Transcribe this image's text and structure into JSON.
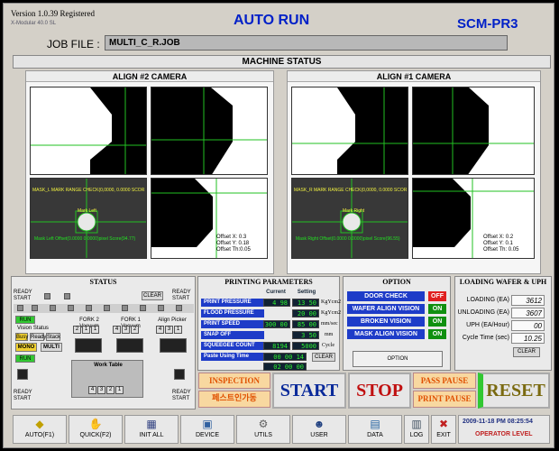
{
  "header": {
    "version": "Version 1.0.39   Registered",
    "subtitle": "X-Modular 40.0 SL",
    "title": "AUTO RUN",
    "model": "SCM-PR3"
  },
  "job": {
    "label": "JOB FILE :",
    "value": "MULTI_C_R.JOB"
  },
  "machine_status": {
    "title": "MACHINE STATUS"
  },
  "cameras": {
    "align2": {
      "title": "ALIGN #2 CAMERA",
      "mask_text": "MASK_L MARK RANGE CHECK(0,0000, 0.0000 SCOR",
      "mark_label": "Mark Left",
      "mark_info": "Mask Left Offset(0.0000 0.0000)pixel Score(94.77)",
      "offset_x": "Offset X:  0.3",
      "offset_y": "Offset Y:  0.18",
      "offset_th": "Offset Th:0.05"
    },
    "align1": {
      "title": "ALIGN #1 CAMERA",
      "mask_text": "MASK_R MARK RANGE CHECK(0,0000, 0.0000 SCOR",
      "mark_label": "Mark Right",
      "mark_info": "Mask Right Offset(0.0000 0.0000)pixel Score(96.55)",
      "offset_x": "Offset X:  0.2",
      "offset_y": "Offset Y:  0.1",
      "offset_th": "Offset Th: 0.05"
    }
  },
  "status": {
    "title": "STATUS",
    "ready": "READY",
    "start": "START",
    "clear": "CLEAR",
    "run": "RUN",
    "vision_status": "Vision Status",
    "busy": "Busy",
    "ready_small": "Ready",
    "stack": "Stack",
    "mono": "MONO",
    "multi": "MULTI",
    "fork2": "FORK 2 Vacuum",
    "fork1": "FORK 1 Vacuum",
    "align_picker": "Align Picker",
    "work_table": "Work Table",
    "nums": [
      "2",
      "1",
      "1",
      "4",
      "3",
      "2",
      "1"
    ]
  },
  "printing": {
    "title": "PRINTING PARAMETERS",
    "col_current": "Current",
    "col_setting": "Setting",
    "rows": [
      {
        "label": "PRINT PRESSURE",
        "current": "4 98",
        "setting": "13 50",
        "unit": "KgYcm2"
      },
      {
        "label": "FLOOD PRESSURE",
        "current": "",
        "setting": "20 00",
        "unit": "KgYcm2"
      },
      {
        "label": "PRINT SPEED",
        "current": "300 00",
        "setting": "85 00",
        "unit": "mm/sec"
      },
      {
        "label": "SNAP OFF",
        "current": "",
        "setting": "3 50",
        "unit": "mm"
      },
      {
        "label": "SQUEEGEE COUNT",
        "current": "8194",
        "setting": "5000",
        "unit": "Cycle"
      },
      {
        "label": "Paste Using Time",
        "current": "00 00 14",
        "setting": "",
        "unit": ""
      }
    ],
    "clear": "CLEAR",
    "extra": "02 00 00"
  },
  "option": {
    "title": "OPTION",
    "rows": [
      {
        "label": "DOOR CHECK",
        "state": "OFF",
        "color": "#e02020"
      },
      {
        "label": "WAFER ALIGN VISION",
        "state": "ON",
        "color": "#109010"
      },
      {
        "label": "BROKEN VISION",
        "state": "ON",
        "color": "#109010"
      },
      {
        "label": "MASK ALIGN VISION",
        "state": "ON",
        "color": "#109010"
      }
    ],
    "button": "OPTION"
  },
  "loading": {
    "title": "LOADING WAFER & UPH",
    "rows": [
      {
        "label": "LOADING (EA)",
        "value": "3612"
      },
      {
        "label": "UNLOADING (EA)",
        "value": "3607"
      },
      {
        "label": "UPH (EA/Hour)",
        "value": "00"
      },
      {
        "label": "Cycle Time (sec)",
        "value": "10.25"
      }
    ],
    "clear": "CLEAR"
  },
  "controls": {
    "inspection": "INSPECTION",
    "paste": "페스트인가동",
    "start": "START",
    "stop": "STOP",
    "pass_pause": "PASS PAUSE",
    "print_pause": "PRINT PAUSE",
    "reset": "RESET"
  },
  "toolbar": {
    "auto": "AUTO(F1)",
    "quick": "QUICK(F2)",
    "init_all": "INIT ALL",
    "device": "DEVICE",
    "utils": "UTILS",
    "user": "USER",
    "data": "DATA",
    "log": "LOG",
    "exit": "EXIT",
    "datetime": "2009-11-18 PM 08:25:54",
    "level": "OPERATOR LEVEL"
  },
  "colors": {
    "accent": "#0020c8",
    "label_blue": "#1e3cc8",
    "on_green": "#109010",
    "off_red": "#e02020",
    "start_blue": "#0a2a9a",
    "stop_red": "#c01010",
    "reset_olive": "#7a6a10"
  }
}
